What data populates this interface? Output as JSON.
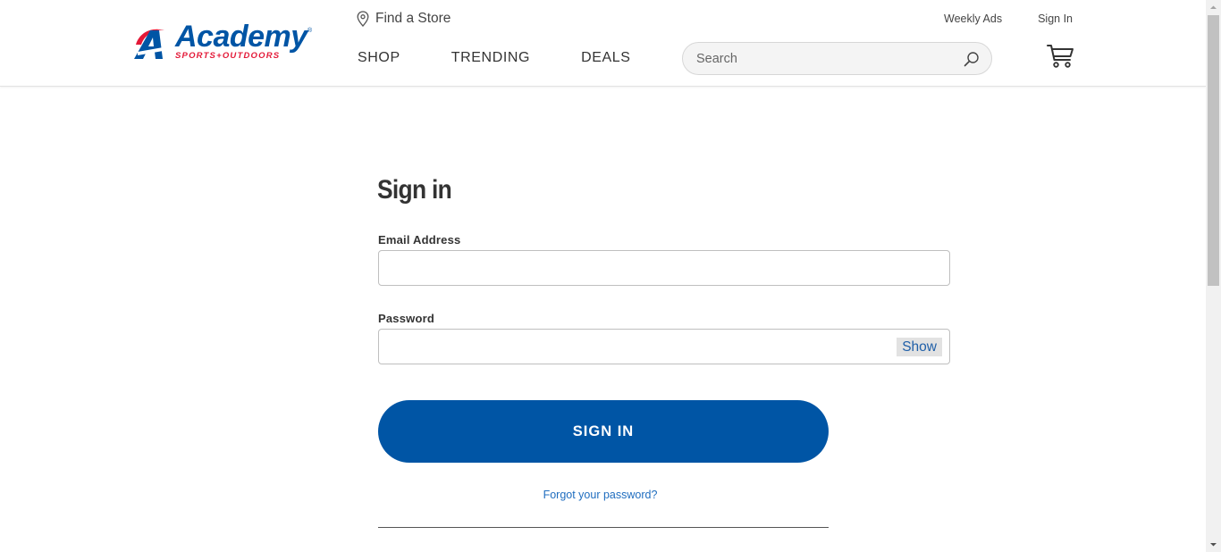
{
  "header": {
    "logo_text": "Academy",
    "logo_subtext": "SPORTS+OUTDOORS",
    "find_store_label": "Find a Store",
    "nav": [
      {
        "label": "SHOP"
      },
      {
        "label": "TRENDING"
      },
      {
        "label": "DEALS"
      }
    ],
    "search_placeholder": "Search",
    "weekly_ads_label": "Weekly Ads",
    "sign_in_link_label": "Sign In"
  },
  "signin": {
    "title": "Sign in",
    "email_label": "Email Address",
    "email_value": "",
    "password_label": "Password",
    "password_value": "",
    "show_label": "Show",
    "submit_label": "SIGN IN",
    "forgot_label": "Forgot your password?"
  },
  "colors": {
    "brand_blue": "#0055a5",
    "brand_red": "#e31837",
    "link_blue": "#1f6dbf"
  },
  "icons": [
    "location-pin-icon",
    "search-icon",
    "cart-icon",
    "academy-logo-icon"
  ]
}
